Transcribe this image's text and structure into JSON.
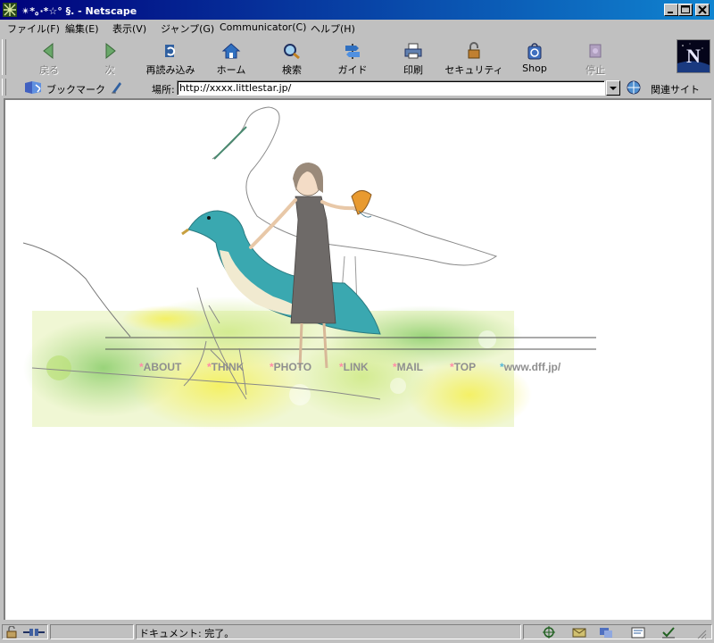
{
  "window": {
    "title": "✴*。·*☆° §. - Netscape"
  },
  "menu": [
    "ファイル(F)",
    "編集(E)",
    "表示(V)",
    "ジャンプ(G)",
    "Communicator(C)",
    "ヘルプ(H)"
  ],
  "toolbar": {
    "back": "戻る",
    "forward": "次",
    "reload": "再読み込み",
    "home": "ホーム",
    "search": "検索",
    "guide": "ガイド",
    "print": "印刷",
    "security": "セキュリティ",
    "shop": "Shop",
    "stop": "停止"
  },
  "location": {
    "bookmarks": "ブックマーク",
    "label": "場所:",
    "url": "http://xxxx.littlestar.jp/",
    "related": "関連サイト"
  },
  "nav": {
    "about": "ABOUT",
    "think": "THINK",
    "photo": "PHOTO",
    "link": "LINK",
    "mail": "MAIL",
    "top": "TOP",
    "external": "www.dff.jp/"
  },
  "status": {
    "text": "ドキュメント: 完了。"
  },
  "colors": {
    "titlebar_start": "#00007b",
    "titlebar_end": "#1084d0",
    "link_star": "#ff8ca8",
    "ext_star": "#55b8d8",
    "link_text": "#8f8f8f"
  }
}
